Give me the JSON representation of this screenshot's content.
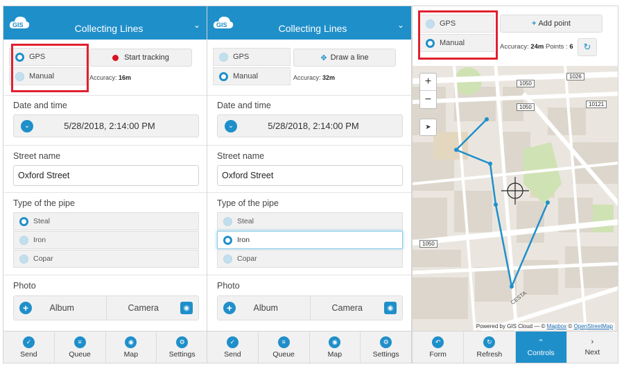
{
  "panels": [
    {
      "title": "Collecting Lines",
      "logo": "GIS",
      "modes": [
        {
          "label": "GPS",
          "selected": true
        },
        {
          "label": "Manual",
          "selected": false
        }
      ],
      "action": {
        "label": "Start tracking",
        "icon": "record-dot-icon"
      },
      "accuracy": {
        "label": "Accuracy:",
        "value": "16m"
      },
      "date": {
        "label": "Date and time",
        "value": "5/28/2018, 2:14:00 PM"
      },
      "street": {
        "label": "Street name",
        "value": "Oxford Street"
      },
      "pipe": {
        "label": "Type of the pipe",
        "options": [
          "Steal",
          "Iron",
          "Copar"
        ],
        "selected": "Steal"
      },
      "photo": {
        "label": "Photo",
        "album": "Album",
        "camera": "Camera"
      },
      "footer": [
        "Send",
        "Queue",
        "Map",
        "Settings"
      ]
    },
    {
      "title": "Collecting Lines",
      "logo": "GIS",
      "modes": [
        {
          "label": "GPS",
          "selected": false
        },
        {
          "label": "Manual",
          "selected": true
        }
      ],
      "action": {
        "label": "Draw a line",
        "icon": "move-icon"
      },
      "accuracy": {
        "label": "Accuracy:",
        "value": "32m"
      },
      "date": {
        "label": "Date and time",
        "value": "5/28/2018, 2:14:00 PM"
      },
      "street": {
        "label": "Street name",
        "value": "Oxford Street"
      },
      "pipe": {
        "label": "Type of the pipe",
        "options": [
          "Steal",
          "Iron",
          "Copar"
        ],
        "selected": "Iron"
      },
      "photo": {
        "label": "Photo",
        "album": "Album",
        "camera": "Camera"
      },
      "footer": [
        "Send",
        "Queue",
        "Map",
        "Settings"
      ]
    }
  ],
  "map_panel": {
    "modes": [
      {
        "label": "GPS",
        "selected": false
      },
      {
        "label": "Manual",
        "selected": true
      }
    ],
    "add_point": "Add point",
    "accuracy_label": "Accuracy:",
    "accuracy_value": "24m",
    "points_label": "Points :",
    "points_value": "6",
    "zoom_in": "+",
    "zoom_out": "−",
    "road_labels": [
      "1026",
      "1050",
      "1050",
      "10121",
      "1050"
    ],
    "street_label": "CESTA",
    "attribution": {
      "prefix": "Powered by GIS Cloud — ©",
      "mapbox": "Mapbox",
      "osm_prefix": "©",
      "osm": "OpenStreetMap"
    },
    "footer": [
      "Form",
      "Refresh",
      "Controls",
      "Next"
    ],
    "footer_active": "Controls",
    "line_color": "#1f8fca"
  },
  "colors": {
    "brand": "#1f8fca",
    "highlight": "#e0202e"
  }
}
